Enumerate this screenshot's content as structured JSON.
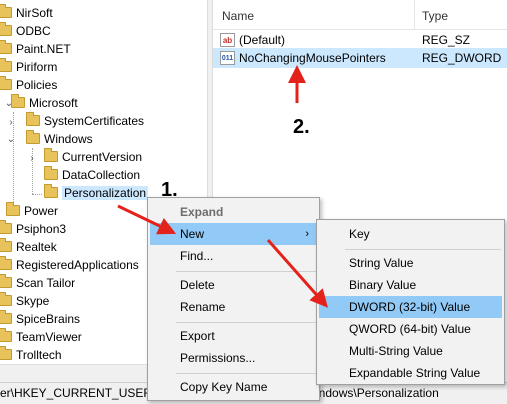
{
  "tree": {
    "items": [
      {
        "label": "NirSoft"
      },
      {
        "label": "ODBC"
      },
      {
        "label": "Paint.NET"
      },
      {
        "label": "Piriform"
      },
      {
        "label": "Policies"
      },
      {
        "label": "Microsoft"
      },
      {
        "label": "SystemCertificates"
      },
      {
        "label": "Windows"
      },
      {
        "label": "CurrentVersion"
      },
      {
        "label": "DataCollection"
      },
      {
        "label": "Personalization"
      },
      {
        "label": "Power"
      },
      {
        "label": "Psiphon3"
      },
      {
        "label": "Realtek"
      },
      {
        "label": "RegisteredApplications"
      },
      {
        "label": "Scan Tailor"
      },
      {
        "label": "Skype"
      },
      {
        "label": "SpiceBrains"
      },
      {
        "label": "TeamViewer"
      },
      {
        "label": "Trolltech"
      }
    ]
  },
  "list": {
    "columns": {
      "name": "Name",
      "type": "Type"
    },
    "rows": [
      {
        "name": "(Default)",
        "type": "REG_SZ",
        "icon": "ab"
      },
      {
        "name": "NoChangingMousePointers",
        "type": "REG_DWORD",
        "icon": "011"
      }
    ]
  },
  "context_menu": {
    "expand": "Expand",
    "new": "New",
    "find": "Find...",
    "delete": "Delete",
    "rename": "Rename",
    "export": "Export",
    "permissions": "Permissions...",
    "copy_key_name": "Copy Key Name"
  },
  "submenu": {
    "key": "Key",
    "string_value": "String Value",
    "binary_value": "Binary Value",
    "dword_value": "DWORD (32-bit) Value",
    "qword_value": "QWORD (64-bit) Value",
    "multi_string_value": "Multi-String Value",
    "expandable_string_value": "Expandable String Value"
  },
  "status_bar": {
    "path_left": "er\\HKEY_CURRENT_USER\\SC",
    "path_right": "indows\\Personalization"
  },
  "annotations": {
    "step1": "1.",
    "step2": "2."
  },
  "colors": {
    "selection": "#cce8ff",
    "menu_highlight": "#91c9f7",
    "arrow": "#e3221c"
  }
}
